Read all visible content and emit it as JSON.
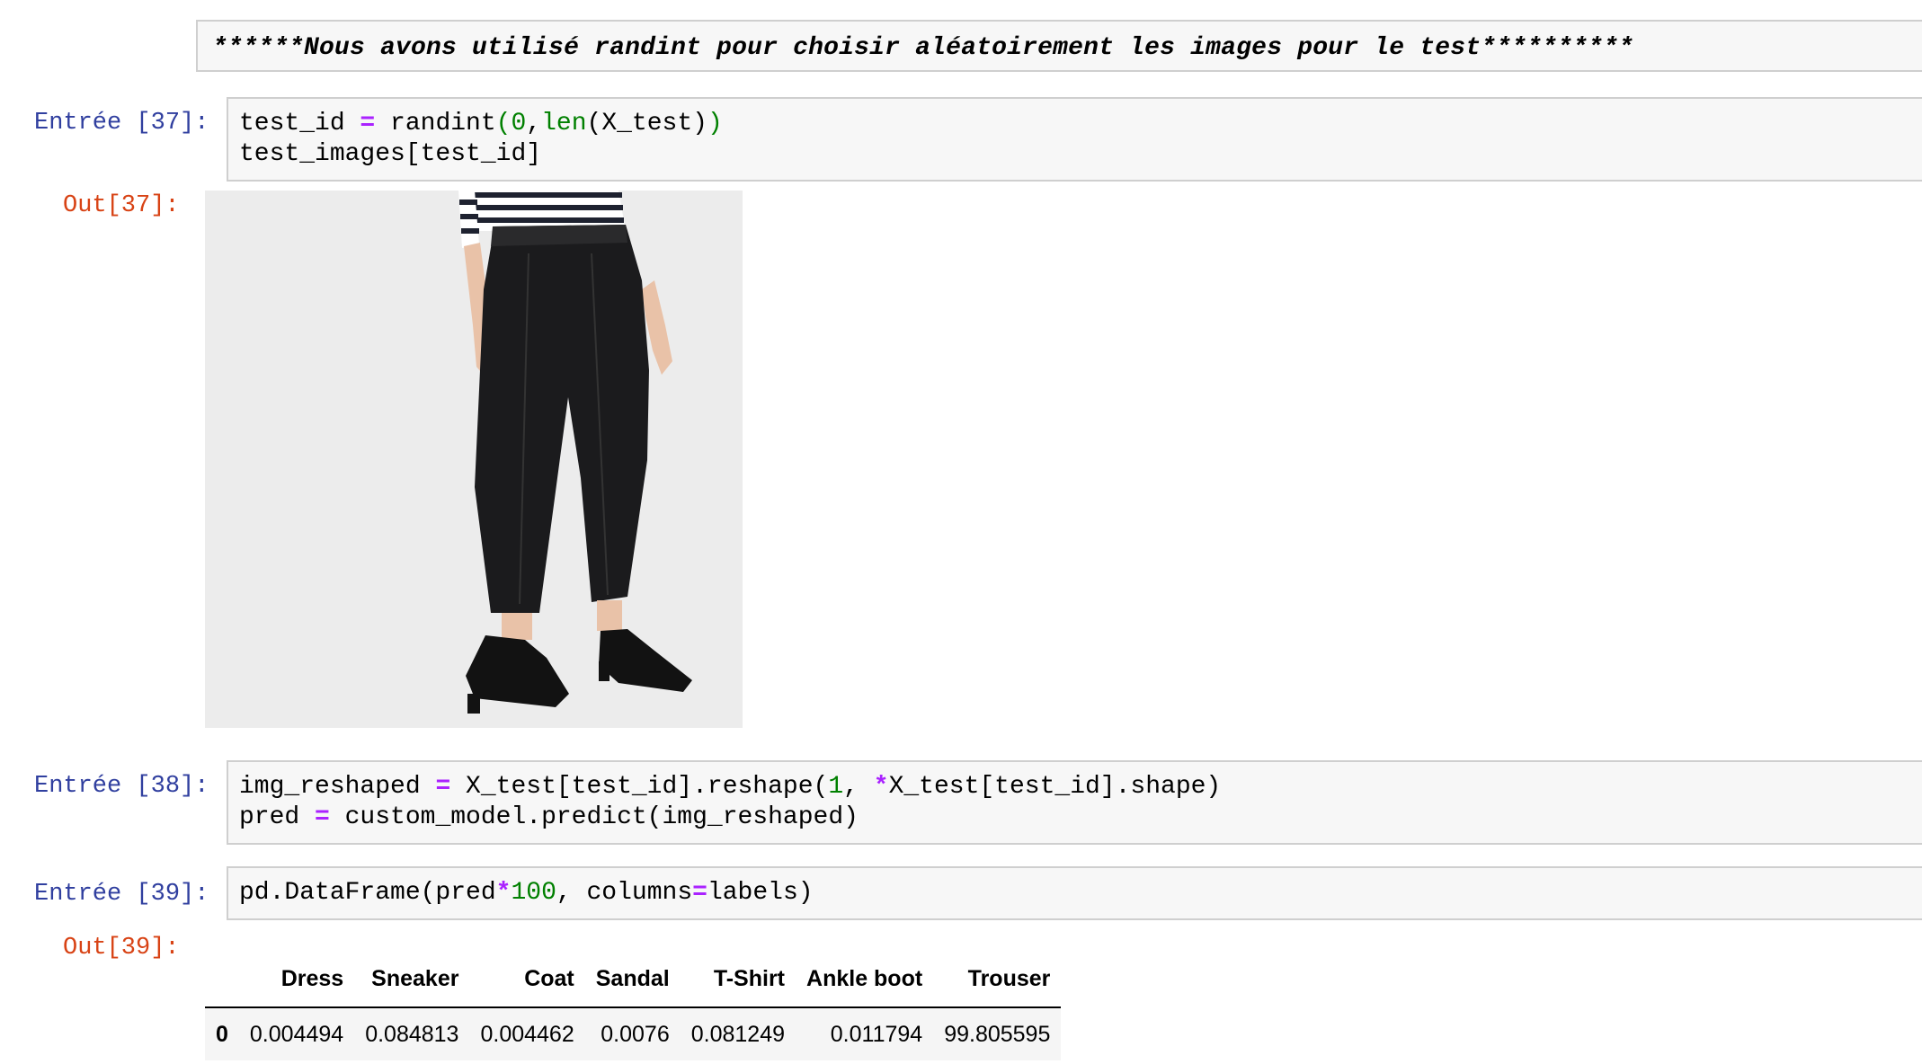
{
  "markdown": {
    "text": "******Nous avons utilisé randint pour choisir aléatoirement les images pour le test**********"
  },
  "cells": {
    "c37": {
      "in_prompt": "Entrée [37]:",
      "out_prompt": "Out[37]:",
      "line1": {
        "t1": "test_id ",
        "t2": "=",
        "t3": " randint",
        "t4": "(",
        "t5": "0",
        "t6": ",",
        "t7": "len",
        "t8": "(X_test)",
        "t9": ")"
      },
      "line2": "test_images[test_id]"
    },
    "c38": {
      "in_prompt": "Entrée [38]:",
      "line1": {
        "t1": "img_reshaped ",
        "t2": "=",
        "t3": " X_test[test_id].reshape(",
        "t4": "1",
        "t5": ", ",
        "t6": "*",
        "t7": "X_test[test_id].shape)"
      },
      "line2": {
        "t1": "pred ",
        "t2": "=",
        "t3": " custom_model.predict(img_reshaped)"
      }
    },
    "c39": {
      "in_prompt": "Entrée [39]:",
      "out_prompt": "Out[39]:",
      "line1": {
        "t1": "pd.DataFrame(pred",
        "t2": "*",
        "t3": "100",
        "t4": ", columns",
        "t5": "=",
        "t6": "labels)"
      }
    }
  },
  "output_image": {
    "description_icon": "product-photo-black-trousers",
    "background": "#ececec"
  },
  "table": {
    "columns": [
      "",
      "Dress",
      "Sneaker",
      "Coat",
      "Sandal",
      "T-Shirt",
      "Ankle boot",
      "Trouser"
    ],
    "rows": [
      [
        "0",
        "0.004494",
        "0.084813",
        "0.004462",
        "0.0076",
        "0.081249",
        "0.011794",
        "99.805595"
      ]
    ]
  },
  "colors": {
    "in_prompt": "#303f9f",
    "out_prompt": "#d84315",
    "operator": "#aa22ff",
    "number": "#008000"
  }
}
